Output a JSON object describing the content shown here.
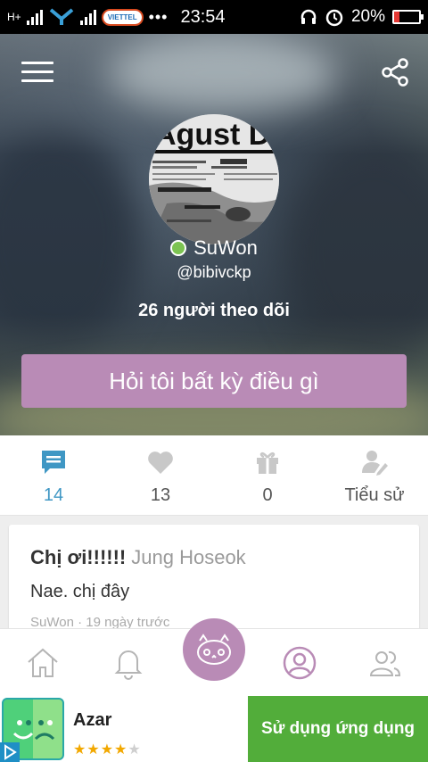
{
  "status_bar": {
    "time": "23:54",
    "battery": "20%",
    "battery_level": 0.2,
    "carrier": "VIETTEL",
    "dots": "•••"
  },
  "profile": {
    "display_name": "SuWon",
    "username": "@bibivckp",
    "followers": "26 người theo dõi",
    "ask_button": "Hỏi tôi bất kỳ điều gì",
    "avatar_text": "Agust D"
  },
  "stats": [
    {
      "icon": "chat-icon",
      "value": "14"
    },
    {
      "icon": "heart-icon",
      "value": "13"
    },
    {
      "icon": "gift-icon",
      "value": "0"
    },
    {
      "icon": "edit-user-icon",
      "value": "Tiểu sử"
    }
  ],
  "card": {
    "question": "Chị ơi!!!!!!",
    "asker": "Jung Hoseok",
    "answer": "Nae. chị đây",
    "meta": "SuWon  · 19 ngày trước"
  },
  "ad": {
    "app_name": "Azar",
    "rating": 4,
    "stars_on": "★★★★",
    "stars_off": "★",
    "cta": "Sử dụng ứng dụng"
  },
  "colors": {
    "accent": "#b98bb6",
    "active_tab": "#3f97c4",
    "cta_green": "#52ad3a",
    "online": "#7cc352"
  }
}
